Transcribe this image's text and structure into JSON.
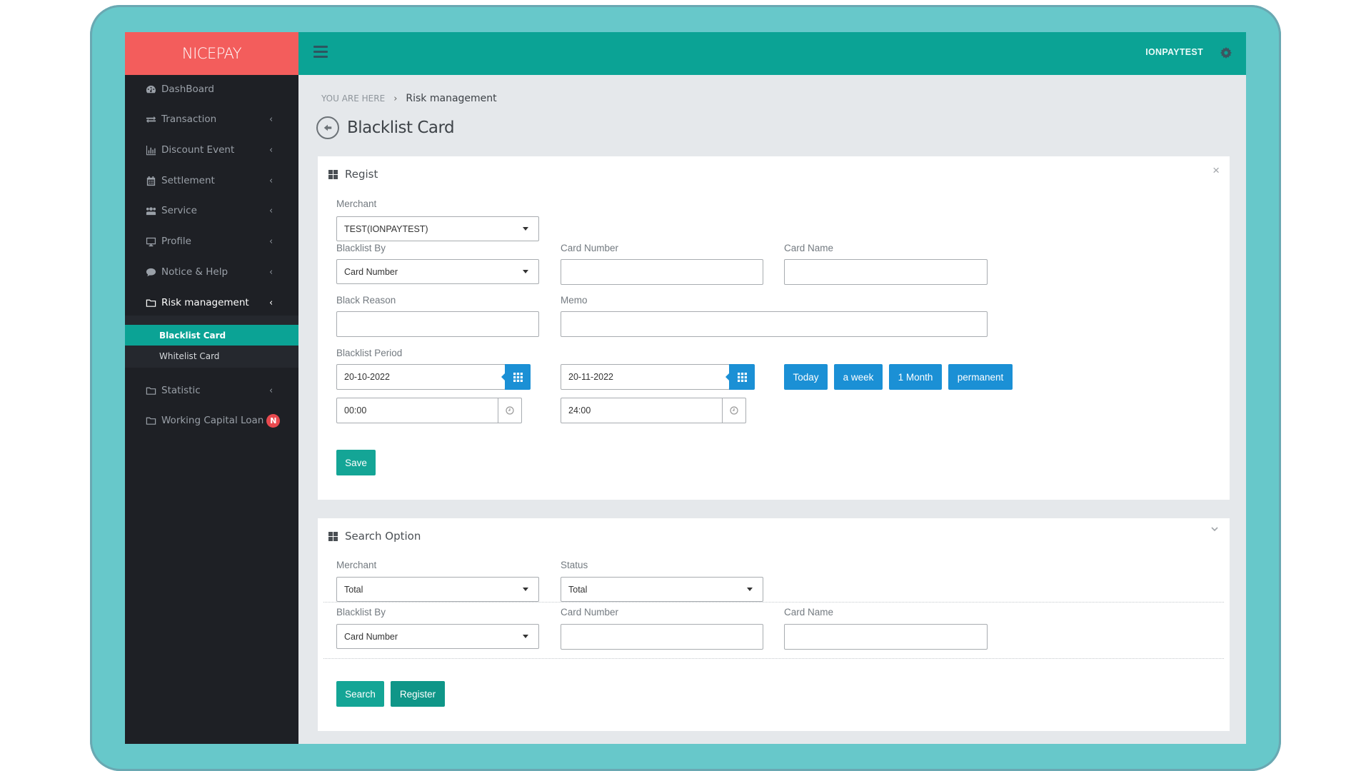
{
  "brand": {
    "name": "NICEPAY",
    "colors": {
      "brand": "#f35d5c",
      "topbar": "#0ba395",
      "sidebar": "#1e2025",
      "primary_blue": "#1b90d5",
      "frame": "#67c8ca"
    }
  },
  "topbar": {
    "user": "IONPAYTEST",
    "menu_icon": "hamburger-icon",
    "settings_icon": "gear-icon"
  },
  "sidebar": {
    "items": [
      {
        "label": "DashBoard",
        "icon": "dashboard-icon",
        "has_children": false
      },
      {
        "label": "Transaction",
        "icon": "exchange-icon",
        "has_children": true
      },
      {
        "label": "Discount Event",
        "icon": "bar-chart-icon",
        "has_children": true
      },
      {
        "label": "Settlement",
        "icon": "calendar-icon",
        "has_children": true
      },
      {
        "label": "Service",
        "icon": "users-icon",
        "has_children": true
      },
      {
        "label": "Profile",
        "icon": "monitor-icon",
        "has_children": true
      },
      {
        "label": "Notice & Help",
        "icon": "comment-icon",
        "has_children": true
      },
      {
        "label": "Risk management",
        "icon": "folder-icon",
        "has_children": true,
        "expanded": true,
        "children": [
          {
            "label": "Blacklist Card",
            "active": true
          },
          {
            "label": "Whitelist Card",
            "active": false
          }
        ]
      },
      {
        "label": "Statistic",
        "icon": "folder-icon",
        "has_children": true
      },
      {
        "label": "Working Capital Loan",
        "icon": "folder-icon",
        "has_children": false,
        "badge": "N"
      }
    ]
  },
  "breadcrumb": {
    "prefix": "YOU ARE HERE",
    "separator": "›",
    "current": "Risk management"
  },
  "page": {
    "title": "Blacklist Card"
  },
  "regist": {
    "title": "Regist",
    "close": "×",
    "merchant": {
      "label": "Merchant",
      "value": "TEST(IONPAYTEST)"
    },
    "blacklist_by": {
      "label": "Blacklist By",
      "value": "Card Number"
    },
    "card_number": {
      "label": "Card Number",
      "value": ""
    },
    "card_name": {
      "label": "Card Name",
      "value": ""
    },
    "black_reason": {
      "label": "Black Reason",
      "value": ""
    },
    "memo": {
      "label": "Memo",
      "value": ""
    },
    "period": {
      "label": "Blacklist Period",
      "start_date": "20-10-2022",
      "end_date": "20-11-2022",
      "start_time": "00:00",
      "end_time": "24:00",
      "quick": [
        "Today",
        "a week",
        "1 Month",
        "permanent"
      ]
    },
    "save": "Save"
  },
  "search": {
    "title": "Search Option",
    "merchant": {
      "label": "Merchant",
      "value": "Total"
    },
    "status": {
      "label": "Status",
      "value": "Total"
    },
    "blacklist_by": {
      "label": "Blacklist By",
      "value": "Card Number"
    },
    "card_number": {
      "label": "Card Number",
      "value": ""
    },
    "card_name": {
      "label": "Card Name",
      "value": ""
    },
    "search_btn": "Search",
    "register_btn": "Register"
  }
}
